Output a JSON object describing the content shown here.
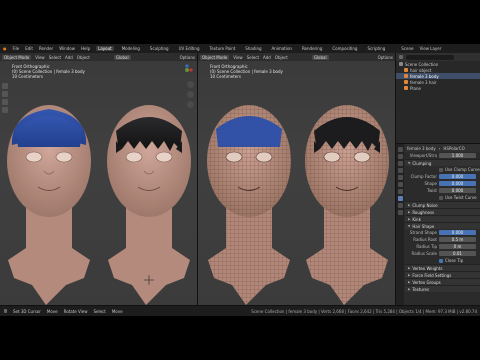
{
  "menu": {
    "items": [
      "File",
      "Edit",
      "Render",
      "Window",
      "Help"
    ],
    "workspaces": [
      "Layout",
      "Modeling",
      "Sculpting",
      "UV Editing",
      "Texture Paint",
      "Shading",
      "Animation",
      "Rendering",
      "Compositing",
      "Scripting"
    ],
    "active_workspace": "Layout",
    "scene": "Scene",
    "view_layer": "View Layer"
  },
  "left_viewport": {
    "mode": "Object Mode",
    "menus": [
      "View",
      "Select",
      "Add",
      "Object"
    ],
    "transform": "Global",
    "options": "Options",
    "overlay": [
      "Front Orthographic",
      "(0) Scene Collection | female 3 body",
      "10 Centimeters"
    ]
  },
  "right_viewport": {
    "mode": "Object Mode",
    "menus": [
      "View",
      "Select",
      "Add",
      "Object"
    ],
    "transform": "Global",
    "options": "Options",
    "overlay": [
      "Front Orthographic",
      "(0) Scene Collection | female 3 body",
      "10 Centimeters"
    ]
  },
  "outliner": {
    "title": "Scene Collection",
    "items": [
      "hair object",
      "female 3 body",
      "female 3 hair",
      "Plane"
    ]
  },
  "properties": {
    "crumbs": [
      "female 3 body",
      "HSPolarCO"
    ],
    "fields": [
      {
        "label": "Viewport/Stra",
        "value": "1.000"
      },
      {
        "label": "Clump Factor",
        "value": "0.000"
      },
      {
        "label": "Shape",
        "value": "0.000"
      },
      {
        "label": "Twist",
        "value": "0.000"
      }
    ],
    "children_label": "Children",
    "clumping_label": "Clumping",
    "clump_curve_label": "Use Clump Curve",
    "twist_curve_label": "Use Twist Curve",
    "sections": [
      "Clump Noise",
      "Roughness",
      "Kink"
    ],
    "hair_shape": {
      "title": "Hair Shape",
      "fields": [
        {
          "label": "Strand Shape",
          "value": "0.000"
        },
        {
          "label": "Radius Root",
          "value": "0.5 m"
        },
        {
          "label": "Radius Tip",
          "value": "0 m"
        },
        {
          "label": "Radius Scale",
          "value": "0.01"
        }
      ],
      "close_tip": "Close Tip"
    },
    "bottom_sections": [
      "Vertex Weights",
      "Force Field Settings",
      "Vertex Groups",
      "Textures"
    ]
  },
  "status": {
    "items": [
      "Set 3D Cursor",
      "Move",
      "Rotate View",
      "Select",
      "Move"
    ],
    "right": "Scene Collection | female 3 body | Verts 2,668 | Faces 2,642 | Tris 5,284 | Objects 1/4 | Mem: 97.3 MiB | v2.80.74"
  },
  "colors": {
    "skin": "#c4988a",
    "skin_shadow": "#9a7466",
    "hair_blue": "#2c4fa8",
    "hair_dark": "#1a1a1c",
    "wire": "#4a3028",
    "accent": "#4772b3"
  }
}
